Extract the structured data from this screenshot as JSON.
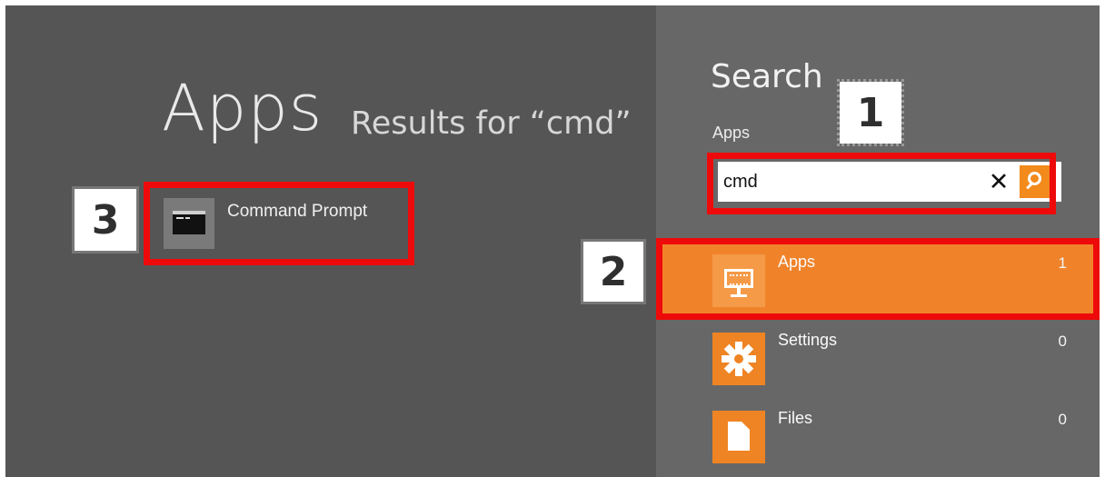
{
  "left": {
    "heading": "Apps",
    "results_for": "Results for “cmd”",
    "results": [
      {
        "label": "Command Prompt",
        "icon": "command-prompt-icon"
      }
    ]
  },
  "right": {
    "title": "Search",
    "scope": "Apps",
    "search_value": "cmd",
    "clear_glyph": "✕",
    "filters": [
      {
        "label": "Apps",
        "count": "1",
        "icon": "keyboard-monitor-icon",
        "active": true
      },
      {
        "label": "Settings",
        "count": "0",
        "icon": "gear-icon",
        "active": false
      },
      {
        "label": "Files",
        "count": "0",
        "icon": "document-icon",
        "active": false
      }
    ]
  },
  "callouts": [
    "1",
    "2",
    "3"
  ],
  "colors": {
    "accent": "#f0832a",
    "highlight_box": "#ee0a0a",
    "left_bg": "#555555",
    "right_bg": "#676767"
  }
}
